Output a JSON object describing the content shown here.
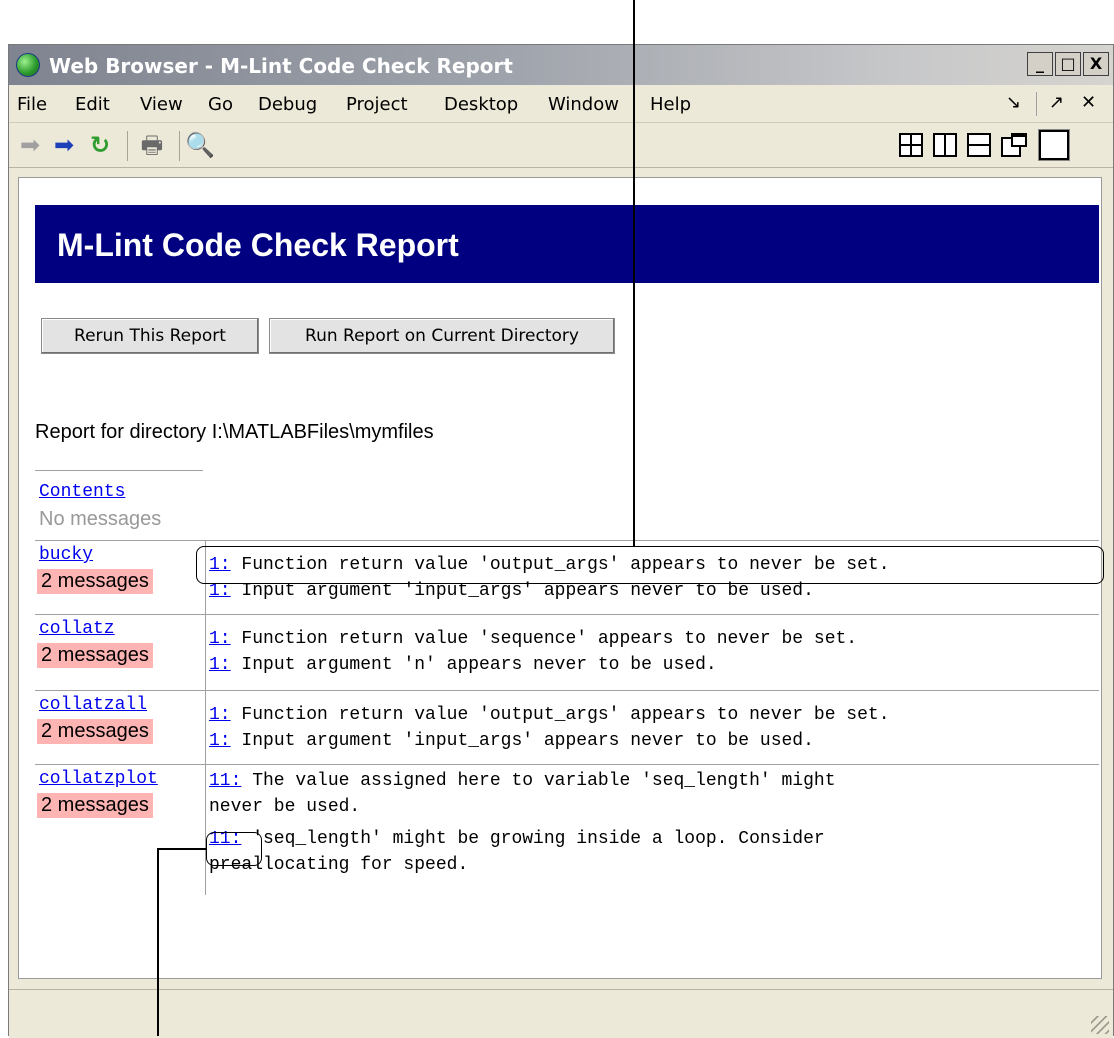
{
  "window": {
    "title": "Web Browser - M-Lint Code Check Report",
    "controls": [
      "_",
      "□",
      "X"
    ]
  },
  "menu": {
    "items": [
      "File",
      "Edit",
      "View",
      "Go",
      "Debug",
      "Project",
      "Desktop",
      "Window",
      "Help"
    ]
  },
  "toolbar": {
    "icons": [
      "back-arrow-icon",
      "forward-arrow-icon",
      "refresh-icon",
      "print-icon",
      "find-icon"
    ],
    "layout_icons": [
      "tile-grid-icon",
      "tile-columns-icon",
      "tile-rows-icon",
      "float-window-icon",
      "maximize-icon"
    ]
  },
  "report": {
    "title": "M-Lint Code Check Report",
    "rerun_button": "Rerun This Report",
    "run_current_button": "Run Report on Current Directory",
    "directory_line": "Report for directory I:\\MATLABFiles\\mymfiles",
    "contents_link": "Contents",
    "contents_status": "No messages",
    "files": [
      {
        "name": "bucky",
        "count": "2 messages",
        "messages": [
          {
            "line": "1:",
            "text": " Function return value 'output_args' appears to never be set."
          },
          {
            "line": "1:",
            "text": " Input argument 'input_args' appears never to be used."
          }
        ]
      },
      {
        "name": "collatz",
        "count": "2 messages",
        "messages": [
          {
            "line": "1:",
            "text": " Function return value 'sequence' appears to never be set."
          },
          {
            "line": "1:",
            "text": " Input argument 'n' appears never to be used."
          }
        ]
      },
      {
        "name": "collatzall",
        "count": "2 messages",
        "messages": [
          {
            "line": "1:",
            "text": " Function return value 'output_args' appears to never be set."
          },
          {
            "line": "1:",
            "text": " Input argument 'input_args' appears never to be used."
          }
        ]
      },
      {
        "name": "collatzplot",
        "count": "2 messages",
        "messages": [
          {
            "line": "11:",
            "text": " The value assigned here to variable 'seq_length' might",
            "cont": "never be used."
          },
          {
            "line": "11:",
            "text": " 'seq_length' might be growing inside a loop. Consider",
            "cont": "preallocating for speed."
          }
        ]
      }
    ]
  }
}
